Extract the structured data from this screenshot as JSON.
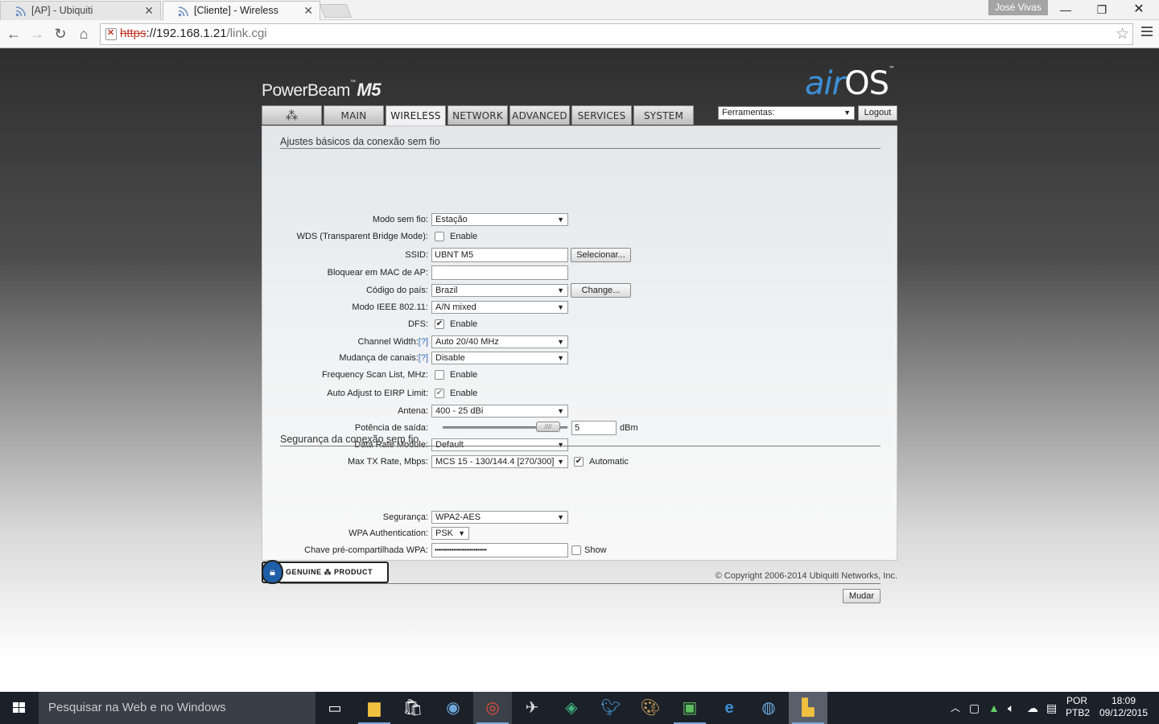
{
  "browser": {
    "tabs": [
      {
        "title": "[AP] - Ubiquiti",
        "active": false
      },
      {
        "title": "[Cliente] - Wireless",
        "active": true
      }
    ],
    "profile_name": "José Vivas",
    "url": {
      "scheme": "https",
      "rest": "://192.168.1.21",
      "path": "/link.cgi"
    }
  },
  "header": {
    "product": "PowerBeam",
    "product_model": "M5",
    "brand_air": "air",
    "brand_os": "OS",
    "tabs": [
      "MAIN",
      "WIRELESS",
      "NETWORK",
      "ADVANCED",
      "SERVICES",
      "SYSTEM"
    ],
    "active_tab": "WIRELESS",
    "tools_select": "Ferramentas:",
    "logout": "Logout"
  },
  "basic": {
    "title": "Ajustes básicos da conexão sem fio",
    "modo_label": "Modo sem fio:",
    "modo_value": "Estação",
    "wds_label": "WDS (Transparent Bridge Mode):",
    "wds_enable": "Enable",
    "wds_checked": false,
    "ssid_label": "SSID:",
    "ssid_value": "UBNT M5",
    "ssid_button": "Selecionar...",
    "mac_label": "Bloquear em MAC de AP:",
    "mac_value": "",
    "country_label": "Código do país:",
    "country_value": "Brazil",
    "country_button": "Change...",
    "ieee_label": "Modo IEEE 802.11:",
    "ieee_value": "A/N mixed",
    "dfs_label": "DFS:",
    "dfs_enable": "Enable",
    "dfs_checked": true,
    "cw_label": "Channel Width:",
    "help": "[?]",
    "cw_value": "Auto 20/40 MHz",
    "shift_label": "Mudança de canais:",
    "shift_value": "Disable",
    "fsl_label": "Frequency Scan List, MHz:",
    "fsl_enable": "Enable",
    "fsl_checked": false,
    "eirp_label": "Auto Adjust to EIRP Limit:",
    "eirp_enable": "Enable",
    "eirp_checked": true,
    "antenna_label": "Antena:",
    "antenna_value": "400 - 25 dBi",
    "power_label": "Potência de saída:",
    "power_value": "5",
    "power_unit": "dBm",
    "power_fraction": 0.8,
    "drm_label": "Data Rate Module:",
    "drm_value": "Default",
    "maxtx_label": "Max TX Rate, Mbps:",
    "maxtx_value": "MCS 15 - 130/144.4 [270/300]",
    "maxtx_auto": "Automatic",
    "maxtx_auto_checked": true
  },
  "security": {
    "title": "Segurança da conexão sem fio",
    "sec_label": "Segurança:",
    "sec_value": "WPA2-AES",
    "wpa_auth_label": "WPA Authentication:",
    "wpa_auth_value": "PSK",
    "psk_label": "Chave pré-compartilhada WPA:",
    "psk_value": "••••••••••••••••••••••••••••",
    "show_label": "Show",
    "show_checked": false
  },
  "actions": {
    "change": "Mudar"
  },
  "footer": {
    "badge_left": "GENUINE",
    "badge_right": "PRODUCT",
    "copyright": "© Copyright 2006-2014 Ubiquiti Networks, Inc."
  },
  "taskbar": {
    "search_placeholder": "Pesquisar na Web e no Windows",
    "lang_top": "POR",
    "lang_bottom": "PTB2",
    "time": "18:09",
    "date": "09/12/2015"
  },
  "colors": {
    "accent": "#3d8fd6",
    "help_link": "#2a6cc1",
    "taskbar": "#1c2129"
  }
}
